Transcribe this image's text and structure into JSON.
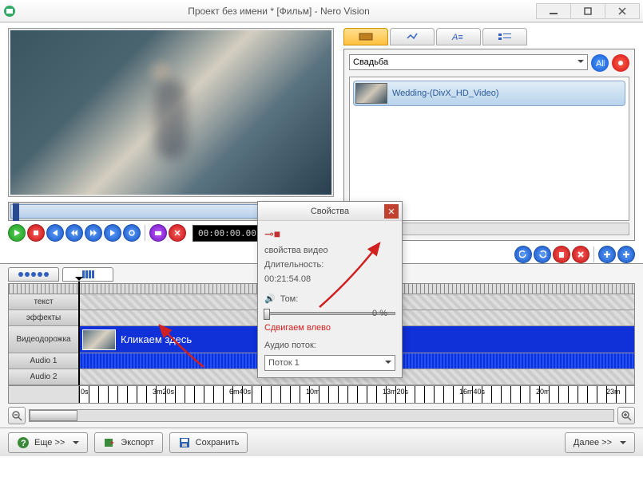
{
  "window": {
    "title": "Проект без имени * [Фильм] - Nero Vision"
  },
  "preview": {
    "timecode": "00:00:00.00"
  },
  "media": {
    "combo": "Свадьба",
    "item_name": "Wedding-(DivX_HD_Video)"
  },
  "timeline": {
    "rows": {
      "text": "текст",
      "effects": "эффекты",
      "video": "Видеодорожка",
      "audio1": "Audio 1",
      "audio2": "Audio 2"
    },
    "clip_text": "Кликаем здесь",
    "ticks": [
      "0s",
      "3m20s",
      "6m40s",
      "10m",
      "13m20s",
      "16m40s",
      "20m",
      "23m"
    ]
  },
  "bottombar": {
    "more": "Еще >>",
    "export": "Экспорт",
    "save": "Сохранить",
    "next": "Далее >>"
  },
  "props": {
    "title": "Свойства",
    "section": "свойства видео",
    "duration_label": "Длительность:",
    "duration_value": "00:21:54.08",
    "tom_label": "Том:",
    "percent": "0 %",
    "slide_text": "Сдвигаем влево",
    "audio_label": "Аудио поток:",
    "audio_value": "Поток 1"
  }
}
